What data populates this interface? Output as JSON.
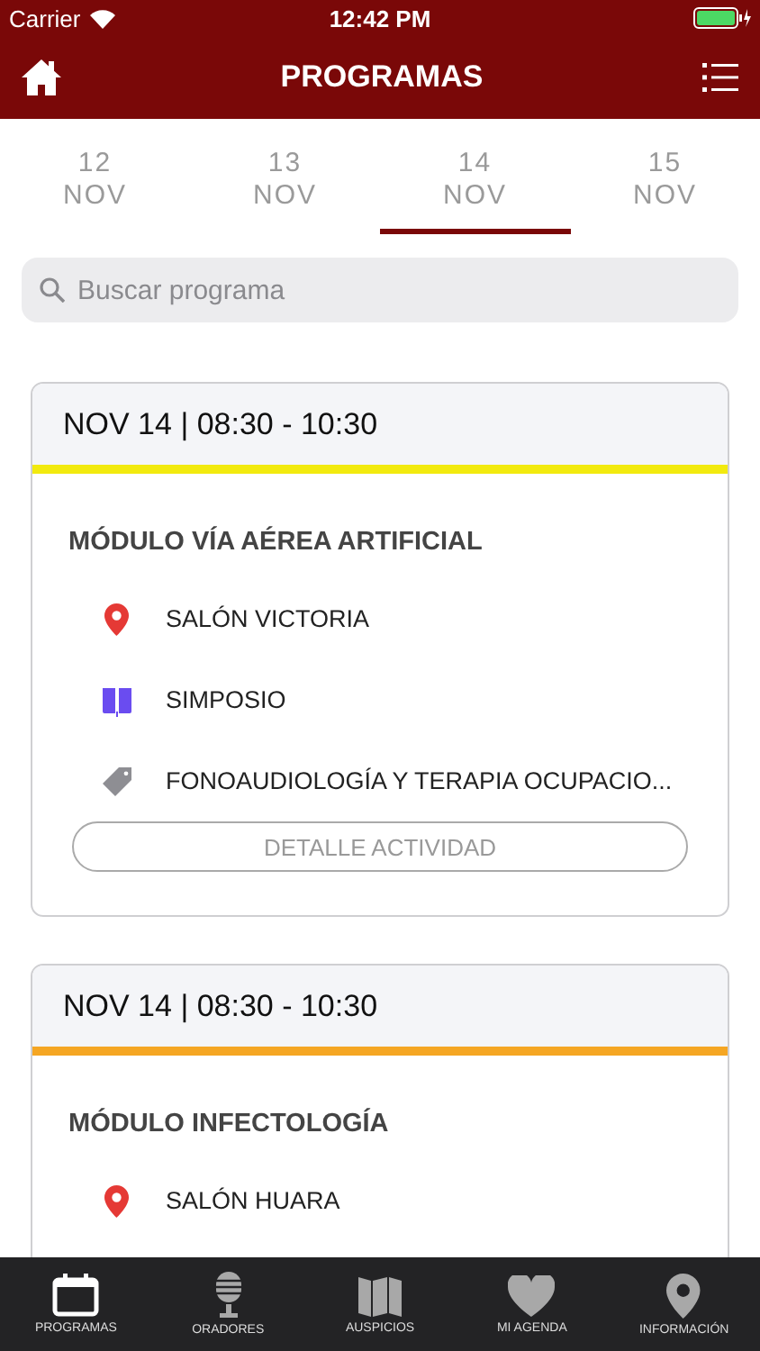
{
  "status_bar": {
    "carrier": "Carrier",
    "time": "12:42 PM"
  },
  "header": {
    "title": "PROGRAMAS"
  },
  "date_tabs": [
    {
      "day": "12",
      "month": "NOV",
      "selected": false
    },
    {
      "day": "13",
      "month": "NOV",
      "selected": false
    },
    {
      "day": "14",
      "month": "NOV",
      "selected": true
    },
    {
      "day": "15",
      "month": "NOV",
      "selected": false
    }
  ],
  "search": {
    "placeholder": "Buscar programa"
  },
  "sessions": [
    {
      "time": "NOV 14 | 08:30 - 10:30",
      "color": "#f2ea0f",
      "title": "MÓDULO VÍA AÉREA ARTIFICIAL",
      "details": [
        {
          "kind": "location",
          "text": "SALÓN VICTORIA"
        },
        {
          "kind": "type",
          "text": "SIMPOSIO"
        },
        {
          "kind": "category",
          "text": "FONOAUDIOLOGÍA Y TERAPIA OCUPACIO..."
        }
      ],
      "button": "DETALLE ACTIVIDAD"
    },
    {
      "time": "NOV 14 | 08:30 - 10:30",
      "color": "#f5a623",
      "title": "MÓDULO INFECTOLOGÍA",
      "details": [
        {
          "kind": "location",
          "text": "SALÓN HUARA"
        }
      ]
    }
  ],
  "tab_bar": [
    {
      "kind": "calendar",
      "label": "PROGRAMAS",
      "selected": true
    },
    {
      "kind": "microphone",
      "label": "ORADORES",
      "selected": false
    },
    {
      "kind": "map",
      "label": "AUSPICIOS",
      "selected": false
    },
    {
      "kind": "heart",
      "label": "MI AGENDA",
      "selected": false
    },
    {
      "kind": "pin",
      "label": "INFORMACIÓN",
      "selected": false
    }
  ]
}
